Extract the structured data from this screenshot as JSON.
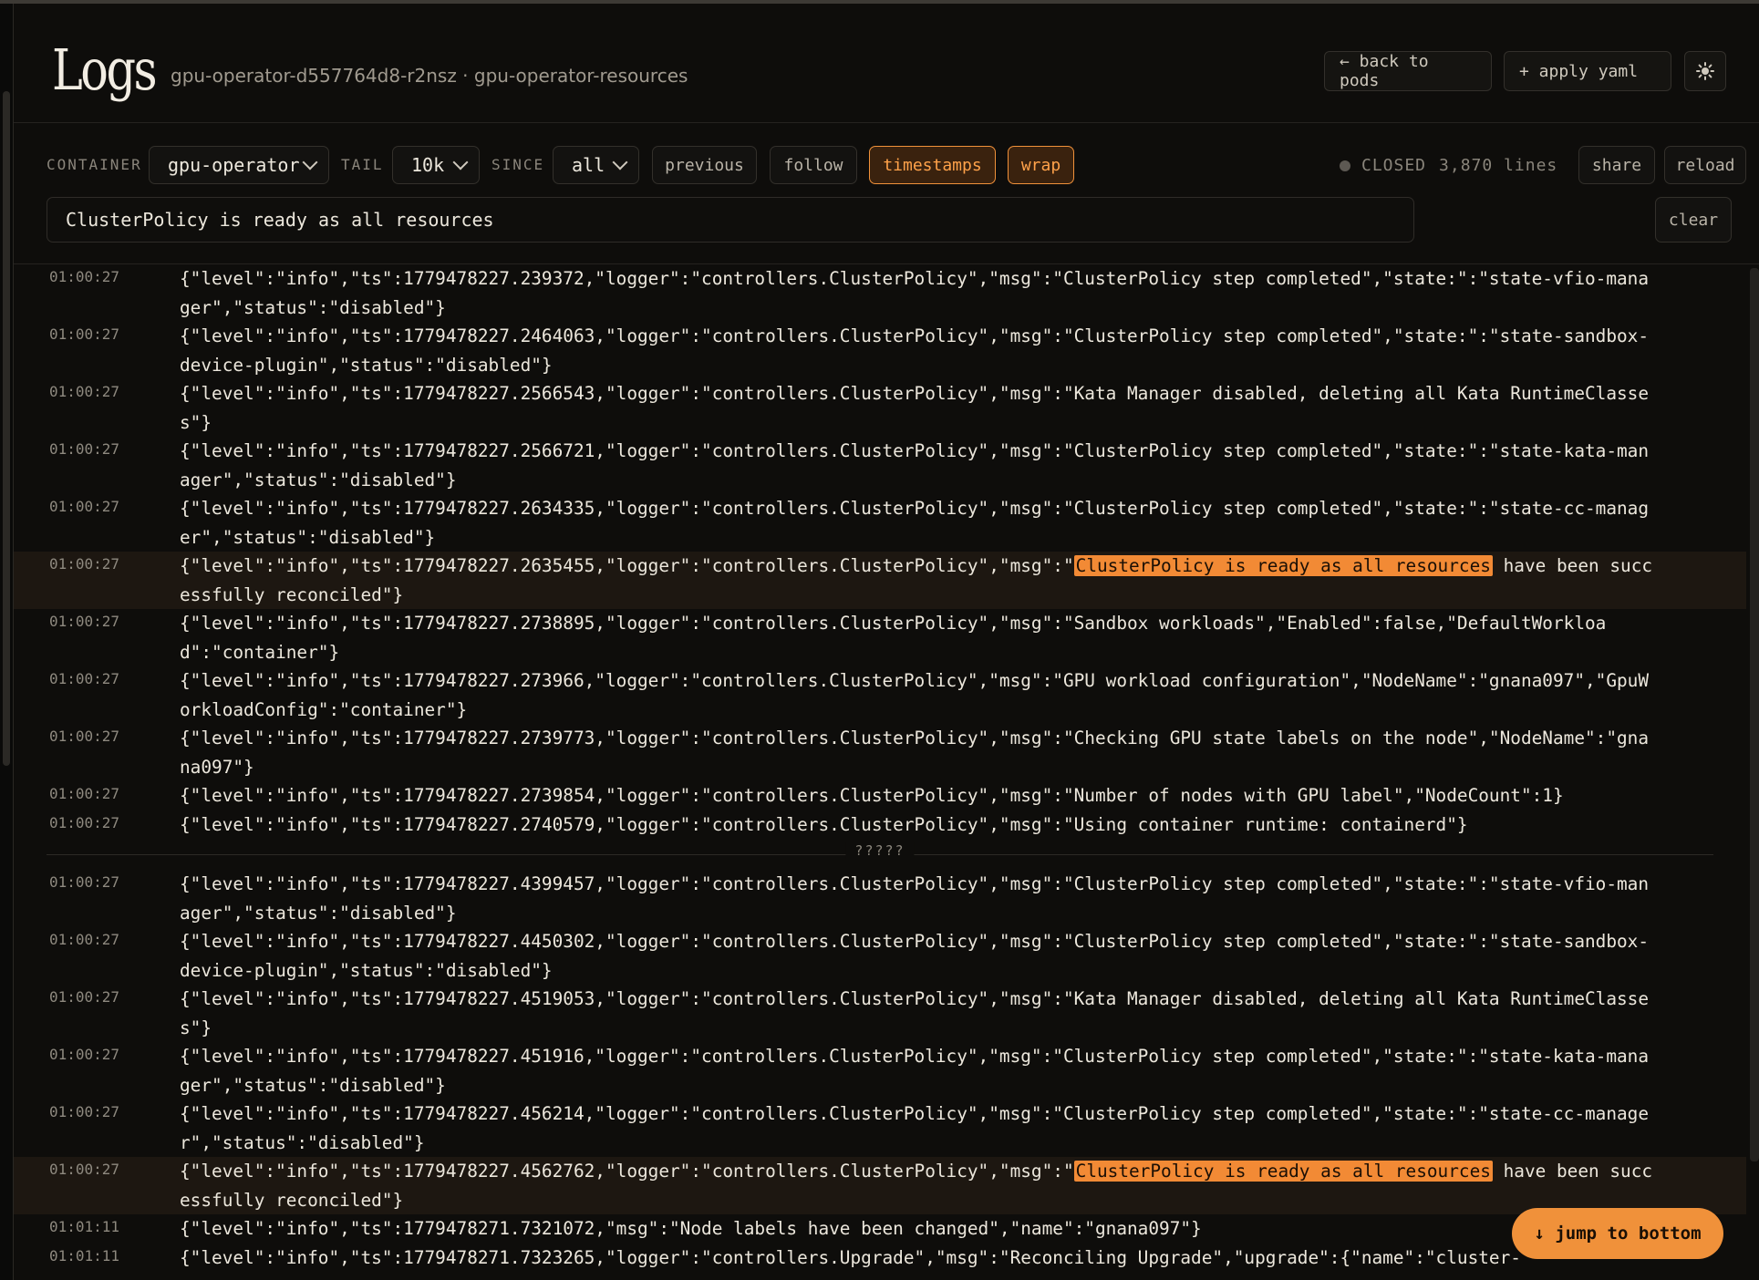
{
  "header": {
    "title": "Logs",
    "subtitle": "gpu-operator-d557764d8-r2nsz · gpu-operator-resources",
    "back_label": "← back to pods",
    "apply_label": "+ apply yaml",
    "theme_icon": "sun-icon"
  },
  "toolbar": {
    "container_label": "CONTAINER",
    "container_value": "gpu-operator",
    "tail_label": "TAIL",
    "tail_value": "10k",
    "since_label": "SINCE",
    "since_value": "all",
    "previous": "previous",
    "follow": "follow",
    "timestamps": "timestamps",
    "wrap": "wrap",
    "status": "CLOSED",
    "lines": "3,870 lines",
    "share": "share",
    "reload": "reload",
    "search_value": "ClusterPolicy is ready as all resources",
    "clear": "clear",
    "accent": "#f0913a"
  },
  "logs": {
    "before": [
      {
        "t": "01:00:27",
        "m": "{\"level\":\"info\",\"ts\":1779478227.239372,\"logger\":\"controllers.ClusterPolicy\",\"msg\":\"ClusterPolicy step completed\",\"state:\":\"state-vfio-manager\",\"status\":\"disabled\"}"
      },
      {
        "t": "01:00:27",
        "m": "{\"level\":\"info\",\"ts\":1779478227.2464063,\"logger\":\"controllers.ClusterPolicy\",\"msg\":\"ClusterPolicy step completed\",\"state:\":\"state-sandbox-device-plugin\",\"status\":\"disabled\"}"
      },
      {
        "t": "01:00:27",
        "m": "{\"level\":\"info\",\"ts\":1779478227.2566543,\"logger\":\"controllers.ClusterPolicy\",\"msg\":\"Kata Manager disabled, deleting all Kata RuntimeClasses\"}"
      },
      {
        "t": "01:00:27",
        "m": "{\"level\":\"info\",\"ts\":1779478227.2566721,\"logger\":\"controllers.ClusterPolicy\",\"msg\":\"ClusterPolicy step completed\",\"state:\":\"state-kata-manager\",\"status\":\"disabled\"}"
      },
      {
        "t": "01:00:27",
        "m": "{\"level\":\"info\",\"ts\":1779478227.2634335,\"logger\":\"controllers.ClusterPolicy\",\"msg\":\"ClusterPolicy step completed\",\"state:\":\"state-cc-manager\",\"status\":\"disabled\"}"
      }
    ],
    "match1": {
      "t": "01:00:27",
      "pre": "{\"level\":\"info\",\"ts\":1779478227.2635455,\"logger\":\"controllers.ClusterPolicy\",\"msg\":\"",
      "hit": "ClusterPolicy is ready as all resources",
      "post": " have been successfully reconciled\"}"
    },
    "middle": [
      {
        "t": "01:00:27",
        "m": "{\"level\":\"info\",\"ts\":1779478227.2738895,\"logger\":\"controllers.ClusterPolicy\",\"msg\":\"Sandbox workloads\",\"Enabled\":false,\"DefaultWorkload\":\"container\"}"
      },
      {
        "t": "01:00:27",
        "m": "{\"level\":\"info\",\"ts\":1779478227.273966,\"logger\":\"controllers.ClusterPolicy\",\"msg\":\"GPU workload configuration\",\"NodeName\":\"gnana097\",\"GpuWorkloadConfig\":\"container\"}"
      },
      {
        "t": "01:00:27",
        "m": "{\"level\":\"info\",\"ts\":1779478227.2739773,\"logger\":\"controllers.ClusterPolicy\",\"msg\":\"Checking GPU state labels on the node\",\"NodeName\":\"gnana097\"}"
      },
      {
        "t": "01:00:27",
        "m": "{\"level\":\"info\",\"ts\":1779478227.2739854,\"logger\":\"controllers.ClusterPolicy\",\"msg\":\"Number of nodes with GPU label\",\"NodeCount\":1}"
      },
      {
        "t": "01:00:27",
        "m": "{\"level\":\"info\",\"ts\":1779478227.2740579,\"logger\":\"controllers.ClusterPolicy\",\"msg\":\"Using container runtime: containerd\"}"
      }
    ],
    "separator": "?????",
    "after": [
      {
        "t": "01:00:27",
        "m": "{\"level\":\"info\",\"ts\":1779478227.4399457,\"logger\":\"controllers.ClusterPolicy\",\"msg\":\"ClusterPolicy step completed\",\"state:\":\"state-vfio-manager\",\"status\":\"disabled\"}"
      },
      {
        "t": "01:00:27",
        "m": "{\"level\":\"info\",\"ts\":1779478227.4450302,\"logger\":\"controllers.ClusterPolicy\",\"msg\":\"ClusterPolicy step completed\",\"state:\":\"state-sandbox-device-plugin\",\"status\":\"disabled\"}"
      },
      {
        "t": "01:00:27",
        "m": "{\"level\":\"info\",\"ts\":1779478227.4519053,\"logger\":\"controllers.ClusterPolicy\",\"msg\":\"Kata Manager disabled, deleting all Kata RuntimeClasses\"}"
      },
      {
        "t": "01:00:27",
        "m": "{\"level\":\"info\",\"ts\":1779478227.451916,\"logger\":\"controllers.ClusterPolicy\",\"msg\":\"ClusterPolicy step completed\",\"state:\":\"state-kata-manager\",\"status\":\"disabled\"}"
      },
      {
        "t": "01:00:27",
        "m": "{\"level\":\"info\",\"ts\":1779478227.456214,\"logger\":\"controllers.ClusterPolicy\",\"msg\":\"ClusterPolicy step completed\",\"state:\":\"state-cc-manager\",\"status\":\"disabled\"}"
      }
    ],
    "match2": {
      "t": "01:00:27",
      "pre": "{\"level\":\"info\",\"ts\":1779478227.4562762,\"logger\":\"controllers.ClusterPolicy\",\"msg\":\"",
      "hit": "ClusterPolicy is ready as all resources",
      "post": " have been successfully reconciled\"}"
    },
    "tail": [
      {
        "t": "01:01:11",
        "m": "{\"level\":\"info\",\"ts\":1779478271.7321072,\"msg\":\"Node labels have been changed\",\"name\":\"gnana097\"}"
      },
      {
        "t": "01:01:11",
        "m": "{\"level\":\"info\",\"ts\":1779478271.7323265,\"logger\":\"controllers.Upgrade\",\"msg\":\"Reconciling Upgrade\",\"upgrade\":{\"name\":\"cluster-"
      }
    ]
  },
  "jump_label": "↓ jump to bottom"
}
